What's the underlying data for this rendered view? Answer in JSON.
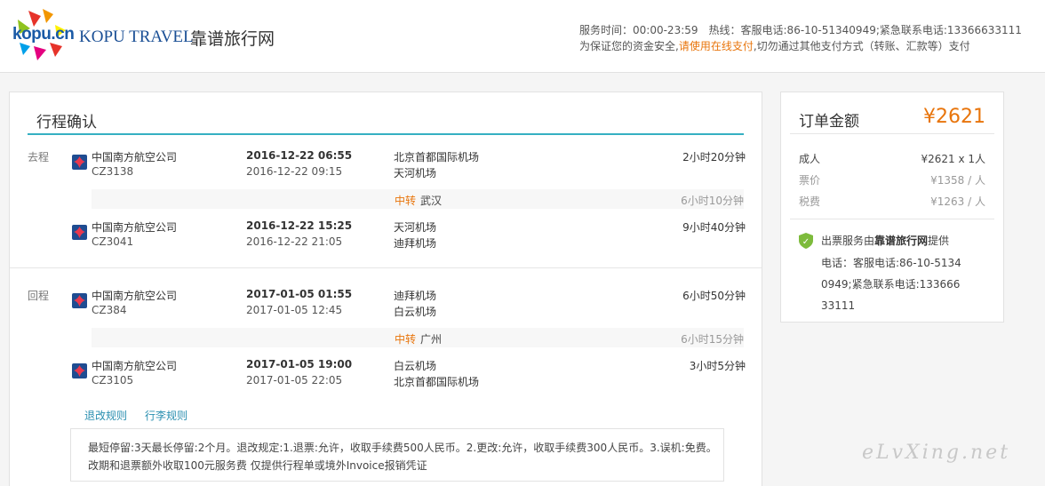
{
  "header": {
    "logo_cn": "kopu.cn",
    "logo_en": "KOPU TRAVEL",
    "logo_zh": "靠谱旅行网",
    "service_time_label": "服务时间：",
    "service_time": "00:00-23:59",
    "hotline": "热线：客服电话:86-10-51340949;紧急联系电话:13366633111",
    "notice_prefix": "为保证您的资金安全,",
    "notice_highlight": "请使用在线支付",
    "notice_suffix": ",切勿通过其他支付方式（转账、汇款等）支付"
  },
  "main": {
    "title": "行程确认",
    "outbound_label": "去程",
    "return_label": "回程",
    "flights": [
      {
        "airline": "中国南方航空公司",
        "number": "CZ3138",
        "dep": "2016-12-22 06:55",
        "arr": "2016-12-22 09:15",
        "from": "北京首都国际机场",
        "to": "天河机场",
        "duration": "2小时20分钟"
      },
      {
        "airline": "中国南方航空公司",
        "number": "CZ3041",
        "dep": "2016-12-22 15:25",
        "arr": "2016-12-22 21:05",
        "from": "天河机场",
        "to": "迪拜机场",
        "duration": "9小时40分钟"
      },
      {
        "airline": "中国南方航空公司",
        "number": "CZ384",
        "dep": "2017-01-05 01:55",
        "arr": "2017-01-05 12:45",
        "from": "迪拜机场",
        "to": "白云机场",
        "duration": "6小时50分钟"
      },
      {
        "airline": "中国南方航空公司",
        "number": "CZ3105",
        "dep": "2017-01-05 19:00",
        "arr": "2017-01-05 22:05",
        "from": "白云机场",
        "to": "北京首都国际机场",
        "duration": "3小时5分钟"
      }
    ],
    "transfers": [
      {
        "label": "中转",
        "city": "武汉",
        "duration": "6小时10分钟"
      },
      {
        "label": "中转",
        "city": "广州",
        "duration": "6小时15分钟"
      }
    ],
    "tabs": [
      "退改规则",
      "行李规则"
    ],
    "rules_text": "最短停留:3天最长停留:2个月。退改规定:1.退票:允许，收取手续费500人民币。2.更改:允许，收取手续费300人民币。3.误机:免费。 改期和退票额外收取100元服务费 仅提供行程单或境外Invoice报销凭证"
  },
  "order": {
    "title": "订单金额",
    "amount": "¥2621",
    "rows": [
      {
        "label": "成人",
        "value": "¥2621 x 1人"
      },
      {
        "label": "票价",
        "value": "¥1358 / 人"
      },
      {
        "label": "税费",
        "value": "¥1263 / 人"
      }
    ],
    "provider_prefix": "出票服务由",
    "provider_name": "靠谱旅行网",
    "provider_suffix": "提供",
    "contact": "电话：客服电话:86-10-51340949;紧急联系电话:13366633111"
  },
  "watermark": "eLvXing.net",
  "colors": {
    "accent": "#35b0c2",
    "price": "#e8750c",
    "link": "#2a8fb0",
    "brand": "#1a4f95"
  }
}
